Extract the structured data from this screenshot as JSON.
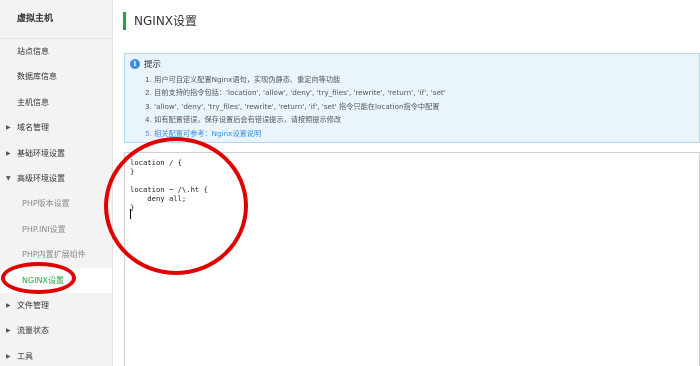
{
  "sidebar": {
    "title": "虚拟主机",
    "items": [
      {
        "label": "站点信息",
        "kind": "item"
      },
      {
        "label": "数据库信息",
        "kind": "item"
      },
      {
        "label": "主机信息",
        "kind": "item"
      },
      {
        "label": "域名管理",
        "kind": "group",
        "caret": "▶"
      },
      {
        "label": "基础环境设置",
        "kind": "group",
        "caret": "▶"
      },
      {
        "label": "高级环境设置",
        "kind": "group",
        "caret": "▼"
      },
      {
        "label": "PHP版本设置",
        "kind": "sub"
      },
      {
        "label": "PHP.INI设置",
        "kind": "sub"
      },
      {
        "label": "PHP内置扩展组件",
        "kind": "sub"
      },
      {
        "label": "NGINX设置",
        "kind": "sub-active"
      },
      {
        "label": "文件管理",
        "kind": "group",
        "caret": "▶"
      },
      {
        "label": "流量状态",
        "kind": "group",
        "caret": "▶"
      },
      {
        "label": "工具",
        "kind": "group",
        "caret": "▶"
      }
    ]
  },
  "main": {
    "title": "NGINX设置",
    "tips": {
      "title": "提示",
      "icon": "info-icon",
      "lines": [
        "1. 用户可自定义配置Nginx语句，实现伪静态、重定向等功能",
        "2. 目前支持的指令包括：'location', 'allow', 'deny', 'try_files', 'rewrite', 'return', 'if', 'set'",
        "3. 'allow', 'deny', 'try_files', 'rewrite', 'return', 'if', 'set' 指令只能在location指令中配置",
        "4. 如有配置错误，保存设置后会有错误提示，请按照提示修改"
      ],
      "link_prefix": "5. 相关配置可参考：",
      "link_text": "Nginx设置说明"
    },
    "editor": {
      "lines": [
        "location / {",
        "}",
        "",
        "location ~ /\\.ht {",
        "    deny all;",
        "}"
      ]
    }
  },
  "colors": {
    "accent": "#20a53a",
    "tips_bg": "#eaf4fb",
    "tips_border": "#b3d8f2",
    "link": "#3a8ee6",
    "annotation": "#e00000"
  }
}
